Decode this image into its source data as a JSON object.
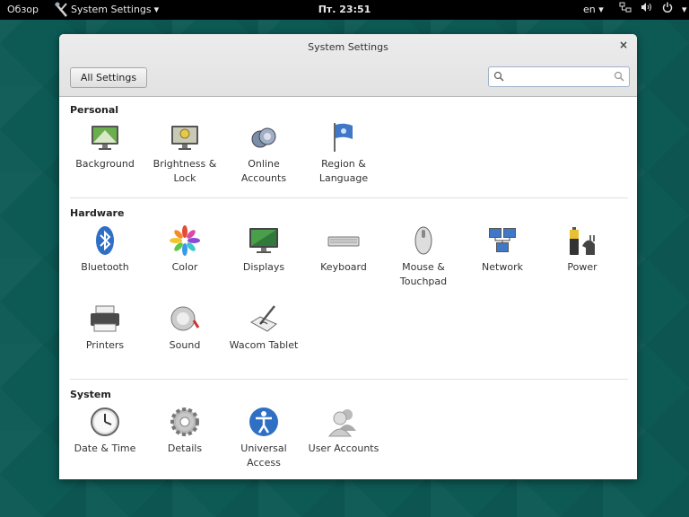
{
  "topbar": {
    "overview": "Обзор",
    "app_menu": "System Settings",
    "app_menu_arrow": "▾",
    "clock": "Пт. 23:51",
    "keyboard_layout": "en",
    "keyboard_arrow": "▾",
    "system_arrow": "▾"
  },
  "window": {
    "title": "System Settings",
    "close": "×",
    "all_settings_label": "All Settings",
    "search": {
      "value": "",
      "placeholder": ""
    }
  },
  "sections": {
    "personal": {
      "title": "Personal",
      "items": [
        {
          "label": "Background",
          "icon": "background-icon"
        },
        {
          "label": "Brightness &\nLock",
          "icon": "brightness-lock-icon"
        },
        {
          "label": "Online\nAccounts",
          "icon": "online-accounts-icon"
        },
        {
          "label": "Region &\nLanguage",
          "icon": "region-flag-icon"
        }
      ]
    },
    "hardware": {
      "title": "Hardware",
      "items": [
        {
          "label": "Bluetooth",
          "icon": "bluetooth-icon"
        },
        {
          "label": "Color",
          "icon": "color-icon"
        },
        {
          "label": "Displays",
          "icon": "displays-icon"
        },
        {
          "label": "Keyboard",
          "icon": "keyboard-icon"
        },
        {
          "label": "Mouse &\nTouchpad",
          "icon": "mouse-icon"
        },
        {
          "label": "Network",
          "icon": "network-icon"
        },
        {
          "label": "Power",
          "icon": "power-icon"
        },
        {
          "label": "Printers",
          "icon": "printer-icon"
        },
        {
          "label": "Sound",
          "icon": "sound-icon"
        },
        {
          "label": "Wacom Tablet",
          "icon": "wacom-tablet-icon"
        }
      ]
    },
    "system": {
      "title": "System",
      "items": [
        {
          "label": "Date & Time",
          "icon": "clock-icon"
        },
        {
          "label": "Details",
          "icon": "gear-icon"
        },
        {
          "label": "Universal\nAccess",
          "icon": "accessibility-icon"
        },
        {
          "label": "User Accounts",
          "icon": "user-accounts-icon"
        }
      ]
    }
  },
  "colors": {
    "desktop": "#0d5a55",
    "topbar": "#000000",
    "window_bg": "#ffffff"
  }
}
